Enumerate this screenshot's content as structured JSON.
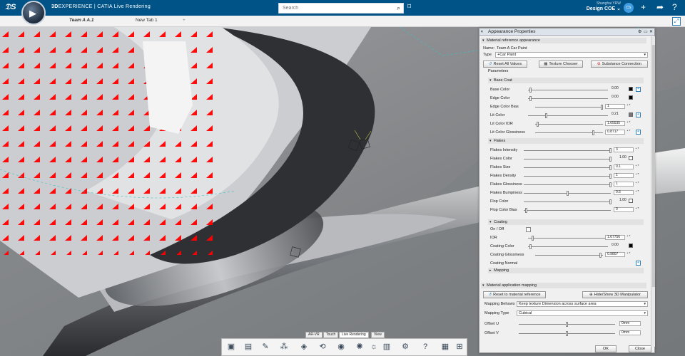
{
  "app": {
    "brand_bold": "3D",
    "brand_rest": "EXPERIENCE | CATIA",
    "brand_app": "Live Rendering",
    "user_name": "Shanghai YRW",
    "role": "Design COE",
    "avatar": "CS"
  },
  "search": {
    "placeholder": "Search"
  },
  "tabs": [
    {
      "label": "Team A A.1"
    },
    {
      "label": "New Tab 1"
    },
    {
      "label": "+"
    }
  ],
  "panel": {
    "title": "Appearance Properties",
    "material_section": "Material reference appearance",
    "name_label": "Name:",
    "name_value": "Team A Car Paint",
    "type_label": "Type",
    "type_value": "+Car Paint",
    "buttons": {
      "reset_all": "Reset All Values",
      "texture": "Texture Chooser",
      "substance": "Substance Connection"
    },
    "parameters": "Parameters",
    "base_coat": {
      "title": "Base Coat",
      "rows": [
        {
          "label": "Base Color",
          "value": "0.00"
        },
        {
          "label": "Edge Color",
          "value": "0.00"
        },
        {
          "label": "Edge Color Bias",
          "value": "1"
        },
        {
          "label": "Lit Color",
          "value": "0.21"
        },
        {
          "label": "Lit Color IOR",
          "value": "1.65535"
        },
        {
          "label": "Lit Color Glossiness",
          "value": "0.8717"
        }
      ]
    },
    "flakes": {
      "title": "Flakes",
      "rows": [
        {
          "label": "Flakes Intensity",
          "value": "3"
        },
        {
          "label": "Flakes Color",
          "value": "1.00"
        },
        {
          "label": "Flakes Size",
          "value": "0.1"
        },
        {
          "label": "Flakes Density",
          "value": "1"
        },
        {
          "label": "Flakes Glossiness",
          "value": "1"
        },
        {
          "label": "Flakes Bumpiness",
          "value": "0.5"
        },
        {
          "label": "Flop Color",
          "value": "1.00"
        },
        {
          "label": "Flop Color Bias",
          "value": "0"
        }
      ]
    },
    "coating": {
      "title": "Coating",
      "rows": [
        {
          "label": "On / Off",
          "value": ""
        },
        {
          "label": "IOR",
          "value": "1.67756"
        },
        {
          "label": "Coating Color",
          "value": "0.00"
        },
        {
          "label": "Coating Glossiness",
          "value": "0.9807"
        },
        {
          "label": "Coating Normal",
          "value": ""
        }
      ]
    },
    "mapping": "Mapping",
    "app_mapping": "Material application mapping",
    "reset_ref": "Reset to material reference",
    "manip": "Hide/Show 3D Manipulator",
    "mapping_behavior_label": "Mapping Behavio",
    "mapping_behavior_value": "Keep texture Dimension across surface area",
    "mapping_type_label": "Mapping Type",
    "mapping_type_value": "Cubical",
    "offset_u_label": "Offset U",
    "offset_u_value": "0mm",
    "offset_v_label": "Offset V",
    "offset_v_value": "0mm",
    "ok": "OK",
    "close": "Close"
  },
  "bottom_tabs": [
    "AR-VR",
    "Touch",
    "Live Rendering",
    "View"
  ],
  "colors": {
    "topbar": "#005386",
    "accent": "#2a7fbf",
    "arrows": "#ff0000"
  }
}
